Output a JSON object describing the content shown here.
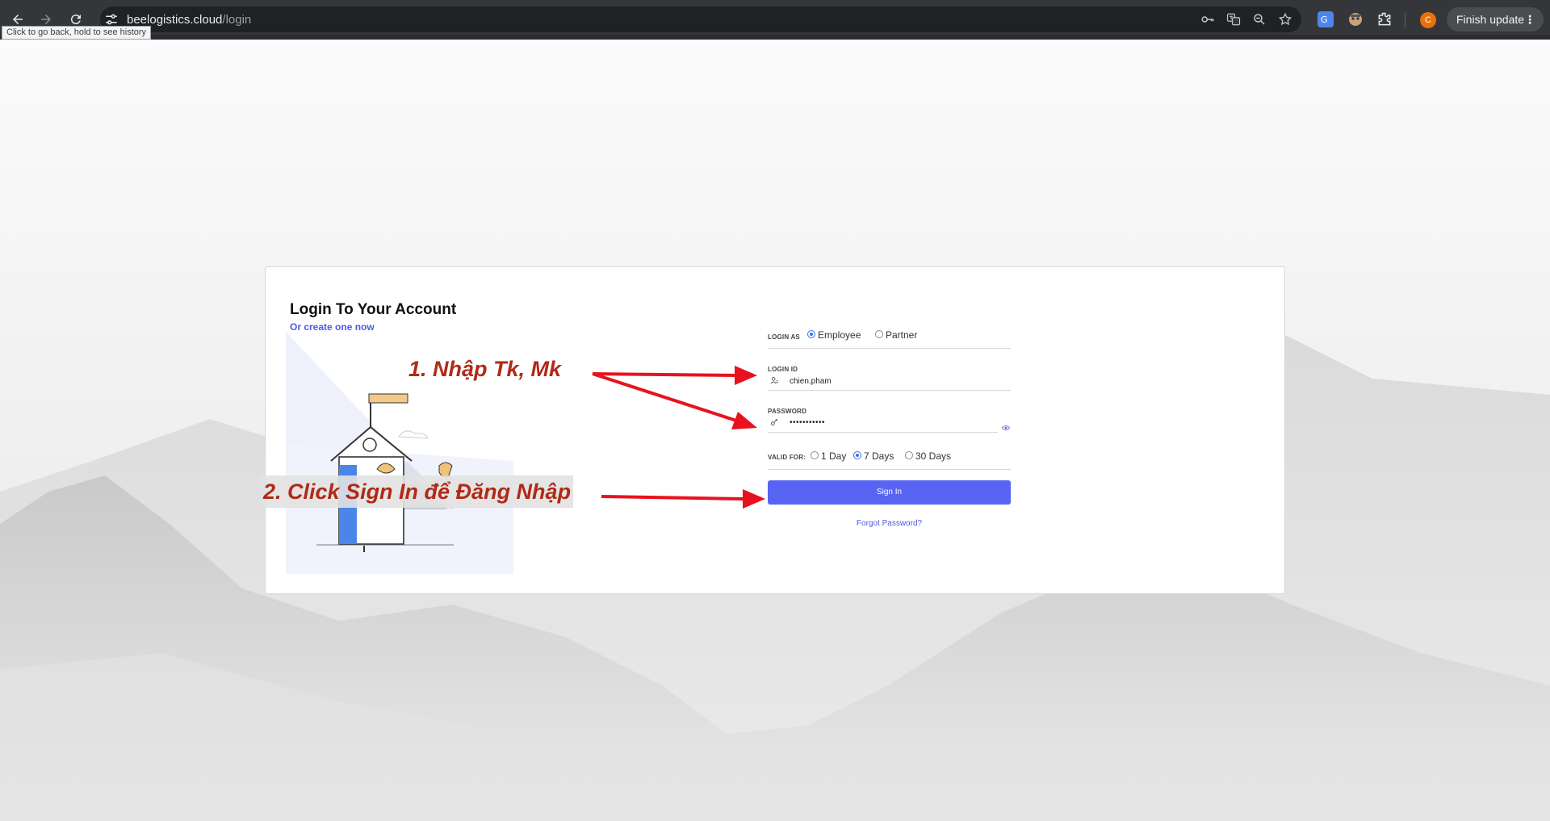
{
  "browser": {
    "url_host": "beelogistics.cloud",
    "url_path": "/login",
    "tooltip": "Click to go back, hold to see history",
    "finish_update": "Finish update",
    "profile_initial": "C",
    "icons": [
      "back-icon",
      "forward-icon",
      "reload-icon",
      "site-settings-icon",
      "password-key-icon",
      "translate-icon",
      "zoom-icon",
      "bookmark-star-icon",
      "extension-translate-icon",
      "extension-avatar-icon",
      "extensions-puzzle-icon",
      "menu-dots-icon"
    ]
  },
  "login": {
    "title": "Login To Your Account",
    "subtitle": "Or create one now",
    "login_as_label": "LOGIN AS",
    "login_as_options": [
      "Employee",
      "Partner"
    ],
    "login_as_selected": "Employee",
    "login_id_label": "LOGIN ID",
    "login_id_value": "chien.pham",
    "password_label": "PASSWORD",
    "password_value": "•••••••••••",
    "valid_for_label": "VALID FOR:",
    "valid_for_options": [
      "1 Day",
      "7 Days",
      "30 Days"
    ],
    "valid_for_selected": "7 Days",
    "sign_in": "Sign In",
    "forgot_password": "Forgot Password?"
  },
  "annotations": {
    "step1": "1. Nhập Tk, Mk",
    "step2": "2. Click Sign In để Đăng Nhập",
    "arrow_color": "#e8121e",
    "text_color": "#b02a17"
  },
  "colors": {
    "accent": "#5864f4",
    "link": "#4c5be6",
    "chrome": "#35363a"
  }
}
